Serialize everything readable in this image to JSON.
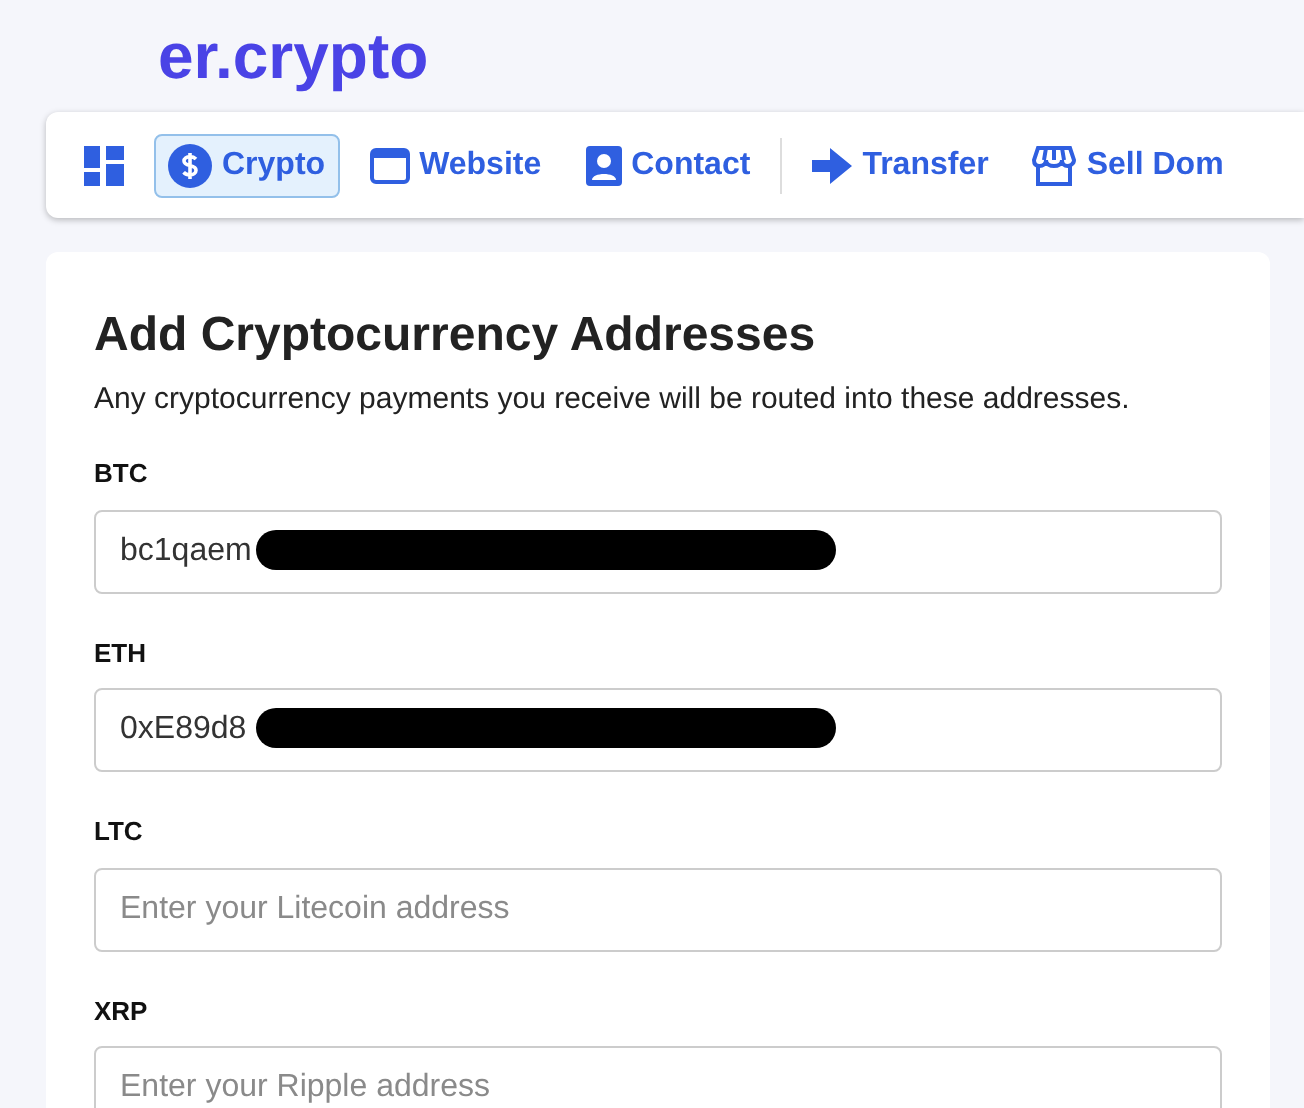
{
  "header": {
    "title": "er.crypto"
  },
  "nav": [
    {
      "kind": "grid",
      "selected": false
    },
    {
      "kind": "dollar",
      "label": "Crypto",
      "selected": true
    },
    {
      "kind": "window",
      "label": "Website",
      "selected": false
    },
    {
      "kind": "contact",
      "label": "Contact",
      "selected": false
    },
    {
      "kind": "divider"
    },
    {
      "kind": "arrow",
      "label": "Transfer",
      "selected": false
    },
    {
      "kind": "store",
      "label": "Sell Dom",
      "selected": false
    }
  ],
  "form": {
    "title": "Add Cryptocurrency Addresses",
    "subtitle": "Any cryptocurrency payments you receive will be routed into these addresses.",
    "fields": [
      {
        "label": "BTC",
        "value": "bc1qaem",
        "redacted": true
      },
      {
        "label": "ETH",
        "value": "0xE89d8",
        "redacted": true
      },
      {
        "label": "LTC",
        "placeholder": "Enter your Litecoin address",
        "redacted": false
      },
      {
        "label": "XRP",
        "placeholder": "Enter your Ripple address",
        "redacted": false
      }
    ]
  }
}
